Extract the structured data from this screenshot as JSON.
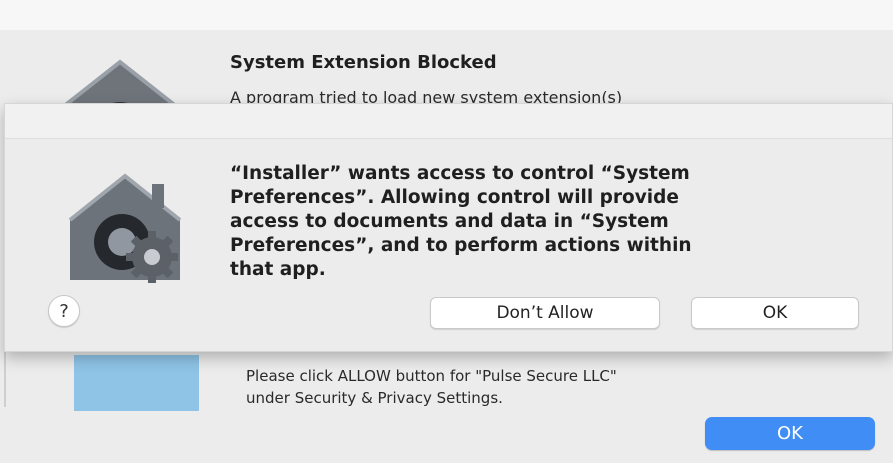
{
  "background_dialog": {
    "title": "System Extension Blocked",
    "text": "A program tried to load new system extension(s)",
    "message_line1": "Please click ALLOW button for \"Pulse Secure LLC\"",
    "message_line2": "under Security & Privacy Settings.",
    "ok_label": "OK",
    "ok_color": "#3f8df5"
  },
  "alert": {
    "message_line1": "“Installer” wants access to control “System",
    "message_line2": "Preferences”. Allowing control will provide",
    "message_line3": "access to documents and data in “System",
    "message_line4": "Preferences”, and to perform actions within",
    "message_line5": "that app.",
    "help_label": "?",
    "dont_allow_label": "Don’t Allow",
    "ok_label": "OK"
  },
  "icons": {
    "alert_icon": "security-preferences-icon",
    "background_icon": "security-preferences-icon"
  }
}
